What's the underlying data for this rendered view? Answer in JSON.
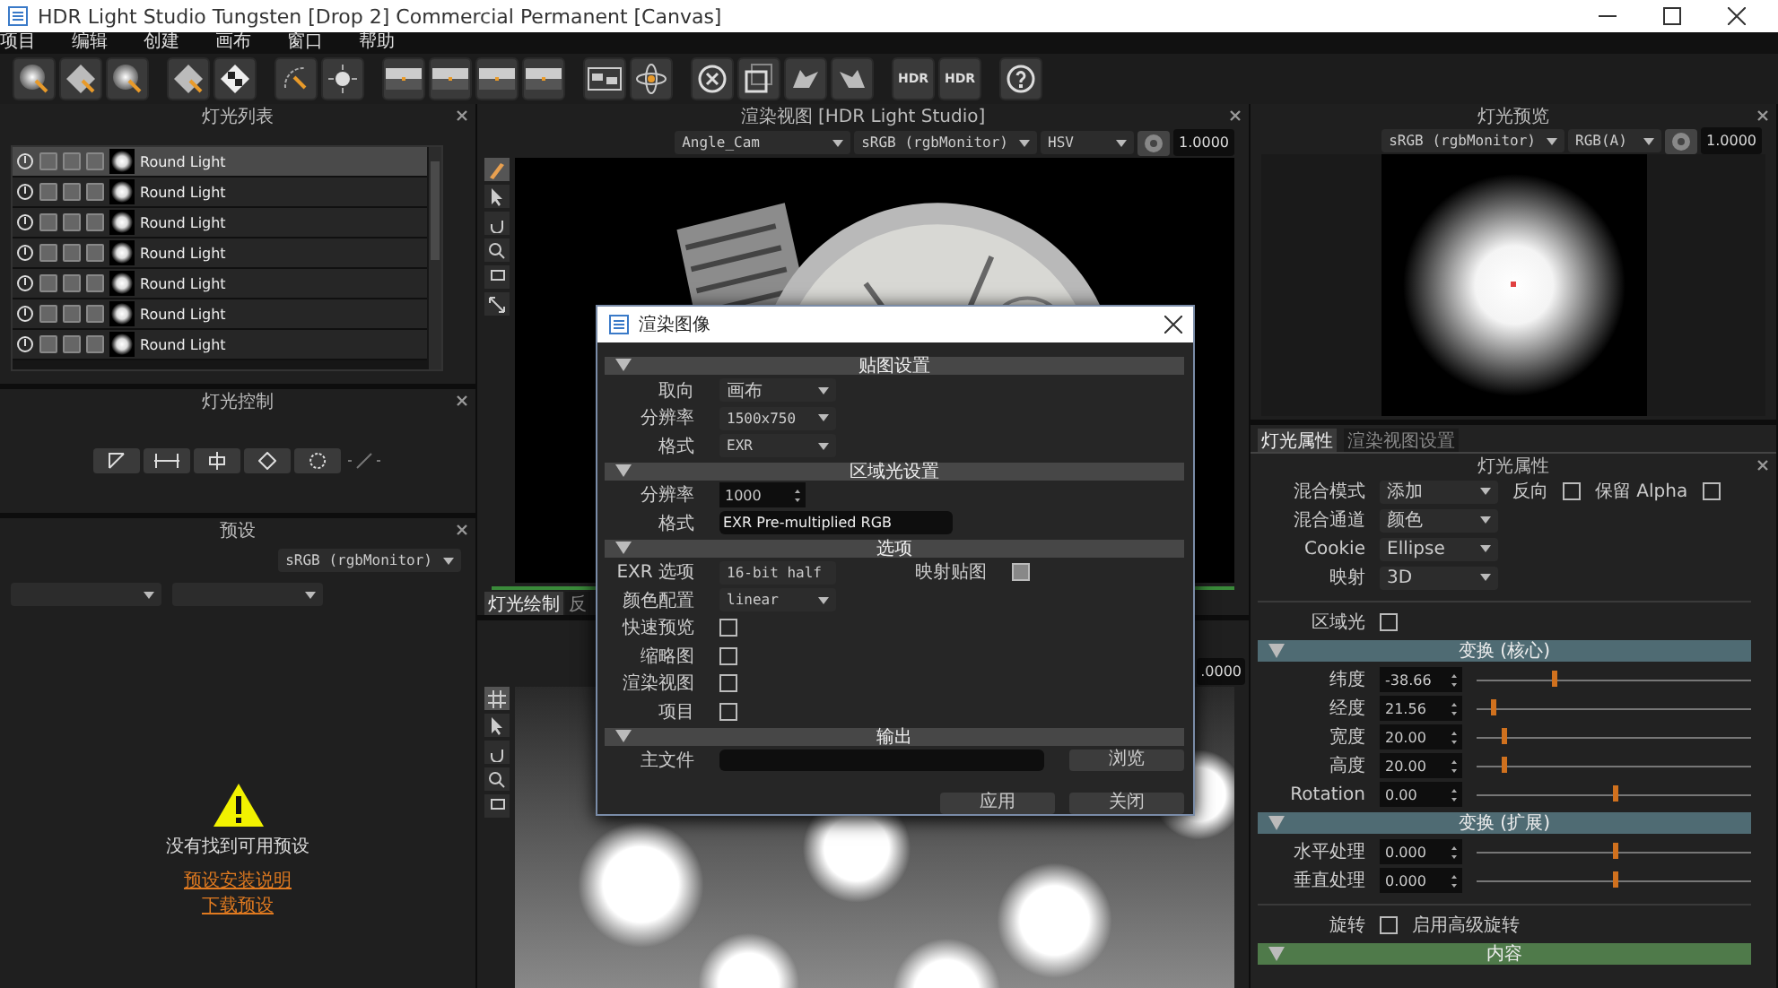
{
  "window": {
    "title": "HDR Light Studio Tungsten [Drop 2] Commercial Permanent [Canvas]"
  },
  "menu": [
    "项目",
    "编辑",
    "创建",
    "画布",
    "窗口",
    "帮助"
  ],
  "toolbar": {
    "hdr_labels": [
      "HDR",
      "HDR"
    ]
  },
  "light_list": {
    "title": "灯光列表",
    "lights": [
      {
        "name": "Round Light",
        "selected": true
      },
      {
        "name": "Round Light",
        "selected": false
      },
      {
        "name": "Round Light",
        "selected": false
      },
      {
        "name": "Round Light",
        "selected": false
      },
      {
        "name": "Round Light",
        "selected": false
      },
      {
        "name": "Round Light",
        "selected": false
      },
      {
        "name": "Round Light",
        "selected": false
      }
    ]
  },
  "light_control": {
    "title": "灯光控制"
  },
  "presets": {
    "title": "预设",
    "color_space": "sRGB (rgbMonitor)",
    "message": "没有找到可用预设",
    "links": [
      "预设安装说明",
      "下载预设"
    ]
  },
  "render_view": {
    "title": "渲染视图 [HDR Light Studio]",
    "camera": "Angle_Cam",
    "color_space": "sRGB (rgbMonitor)",
    "mode": "HSV",
    "exposure": "1.0000",
    "tabs": [
      {
        "label": "灯光绘制",
        "selected": true
      },
      {
        "label": "反",
        "selected": false
      }
    ]
  },
  "lower_view": {
    "exposure": ".0000"
  },
  "light_preview": {
    "title": "灯光预览",
    "color_space": "sRGB (rgbMonitor)",
    "channel": "RGB(A)",
    "exposure": "1.0000"
  },
  "properties": {
    "tabs": [
      {
        "label": "灯光属性",
        "selected": true
      },
      {
        "label": "渲染视图设置",
        "selected": false
      }
    ],
    "title": "灯光属性",
    "rows": [
      {
        "kind": "dropdown",
        "label": "混合模式",
        "value": "添加",
        "extras": [
          {
            "label": "反向",
            "checked": false
          },
          {
            "label": "保留 Alpha",
            "checked": false
          }
        ]
      },
      {
        "kind": "dropdown",
        "label": "混合通道",
        "value": "颜色"
      },
      {
        "kind": "dropdown",
        "label": "Cookie",
        "value": "Ellipse"
      },
      {
        "kind": "dropdown",
        "label": "映射",
        "value": "3D"
      },
      {
        "kind": "checkbox",
        "label": "区域光",
        "checked": false
      },
      {
        "kind": "section",
        "label": "变换 (核心)",
        "expanded": true,
        "color": "#4f6b73"
      },
      {
        "kind": "slider",
        "label": "纬度",
        "value": "-38.66",
        "level": 0.28
      },
      {
        "kind": "slider",
        "label": "经度",
        "value": "21.56",
        "level": 0.06
      },
      {
        "kind": "slider",
        "label": "宽度",
        "value": "20.00",
        "level": 0.1
      },
      {
        "kind": "slider",
        "label": "高度",
        "value": "20.00",
        "level": 0.1
      },
      {
        "kind": "slider",
        "label": "Rotation",
        "value": "0.00",
        "level": 0.5
      },
      {
        "kind": "section",
        "label": "变换 (扩展)",
        "expanded": true,
        "color": "#4f6b73"
      },
      {
        "kind": "slider",
        "label": "水平处理",
        "value": "0.000",
        "level": 0.5
      },
      {
        "kind": "slider",
        "label": "垂直处理",
        "value": "0.000",
        "level": 0.5
      },
      {
        "kind": "checkbox",
        "label": "旋转",
        "checked": false,
        "note": "启用高级旋转"
      },
      {
        "kind": "section",
        "label": "内容",
        "expanded": true,
        "color": "#4f7a4a"
      }
    ]
  },
  "render_dialog": {
    "title": "渲染图像",
    "sections": [
      {
        "title": "贴图设置",
        "expanded": true,
        "rows": [
          {
            "kind": "dropdown",
            "label": "取向",
            "value": "画布"
          },
          {
            "kind": "dropdown",
            "label": "分辨率",
            "value": "1500x750"
          },
          {
            "kind": "dropdown",
            "label": "格式",
            "value": "EXR"
          }
        ]
      },
      {
        "title": "区域光设置",
        "expanded": true,
        "rows": [
          {
            "kind": "spin",
            "label": "分辨率",
            "value": "1000"
          },
          {
            "kind": "text",
            "label": "格式",
            "value": "EXR Pre-multiplied RGB"
          }
        ]
      },
      {
        "title": "选项",
        "expanded": true,
        "rows": [
          {
            "kind": "dropdown",
            "label": "EXR 选项",
            "value": "16-bit half",
            "extra": {
              "label": "映射贴图",
              "checked": true
            }
          },
          {
            "kind": "dropdown",
            "label": "颜色配置",
            "value": "linear"
          },
          {
            "kind": "checkbox",
            "label": "快速预览",
            "checked": false
          },
          {
            "kind": "checkbox",
            "label": "缩略图",
            "checked": false
          },
          {
            "kind": "checkbox",
            "label": "渲染视图",
            "checked": false
          },
          {
            "kind": "checkbox",
            "label": "项目",
            "checked": false
          }
        ]
      },
      {
        "title": "输出",
        "expanded": true,
        "rows": [
          {
            "kind": "file",
            "label": "主文件",
            "button": "浏览"
          }
        ]
      }
    ],
    "buttons": [
      "应用",
      "关闭"
    ]
  }
}
